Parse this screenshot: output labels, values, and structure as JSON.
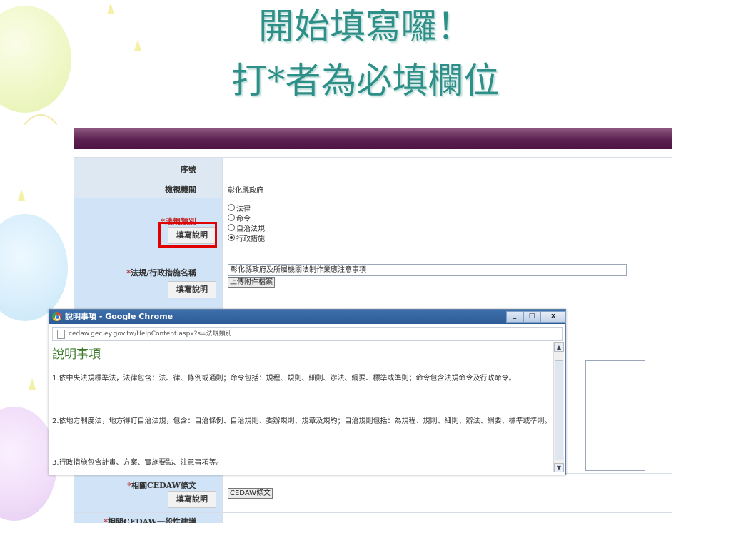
{
  "slide": {
    "title_line1": "開始填寫囉！",
    "title_line2": "打*者為必填欄位"
  },
  "form": {
    "row_serial_label": "序號",
    "row_agency_label": "檢視機關",
    "row_agency_value": "彰化縣政府",
    "row_lawtype_required": "*",
    "row_lawtype_label": "法規類別",
    "help_label": "填寫說明",
    "lawtype_options": [
      "法律",
      "命令",
      "自治法規",
      "行政措施"
    ],
    "lawtype_selected": "行政措施",
    "row_lawname_required": "*",
    "row_lawname_label": "法規/行政措施名稱",
    "row_lawname_value": "彰化縣政府及所屬機關法制作業應注意事項",
    "upload_button": "上傳附件檔案",
    "row_cedaw_required": "*",
    "row_cedaw_label": "相關CEDAW條文",
    "cedaw_button": "CEDAW條文",
    "row_cedaw_general_required": "*",
    "row_cedaw_general_label": "相關CEDAW一般性建議"
  },
  "popup": {
    "window_title": "說明事項 - Google Chrome",
    "url": "cedaw.gec.ey.gov.tw/HelpContent.aspx?s=法規類別",
    "heading": "說明事項",
    "paragraphs": [
      "1.依中央法規標準法，法律包含：法、律、條例或通則；命令包括：規程、規則、細則、辦法、綱要、標準或準則；命令包含法規命令及行政命令。",
      "2.依地方制度法，地方得訂自治法規，包含：自治條例、自治規則、委辦規則、規章及規約；自治規則包括：為規程、規則、細則、辦法、綱要、標準或準則。",
      "3.行政措施包含計畫、方案、實施要點、注意事項等。"
    ],
    "minimize": "_",
    "maximize": "□",
    "close": "x"
  }
}
